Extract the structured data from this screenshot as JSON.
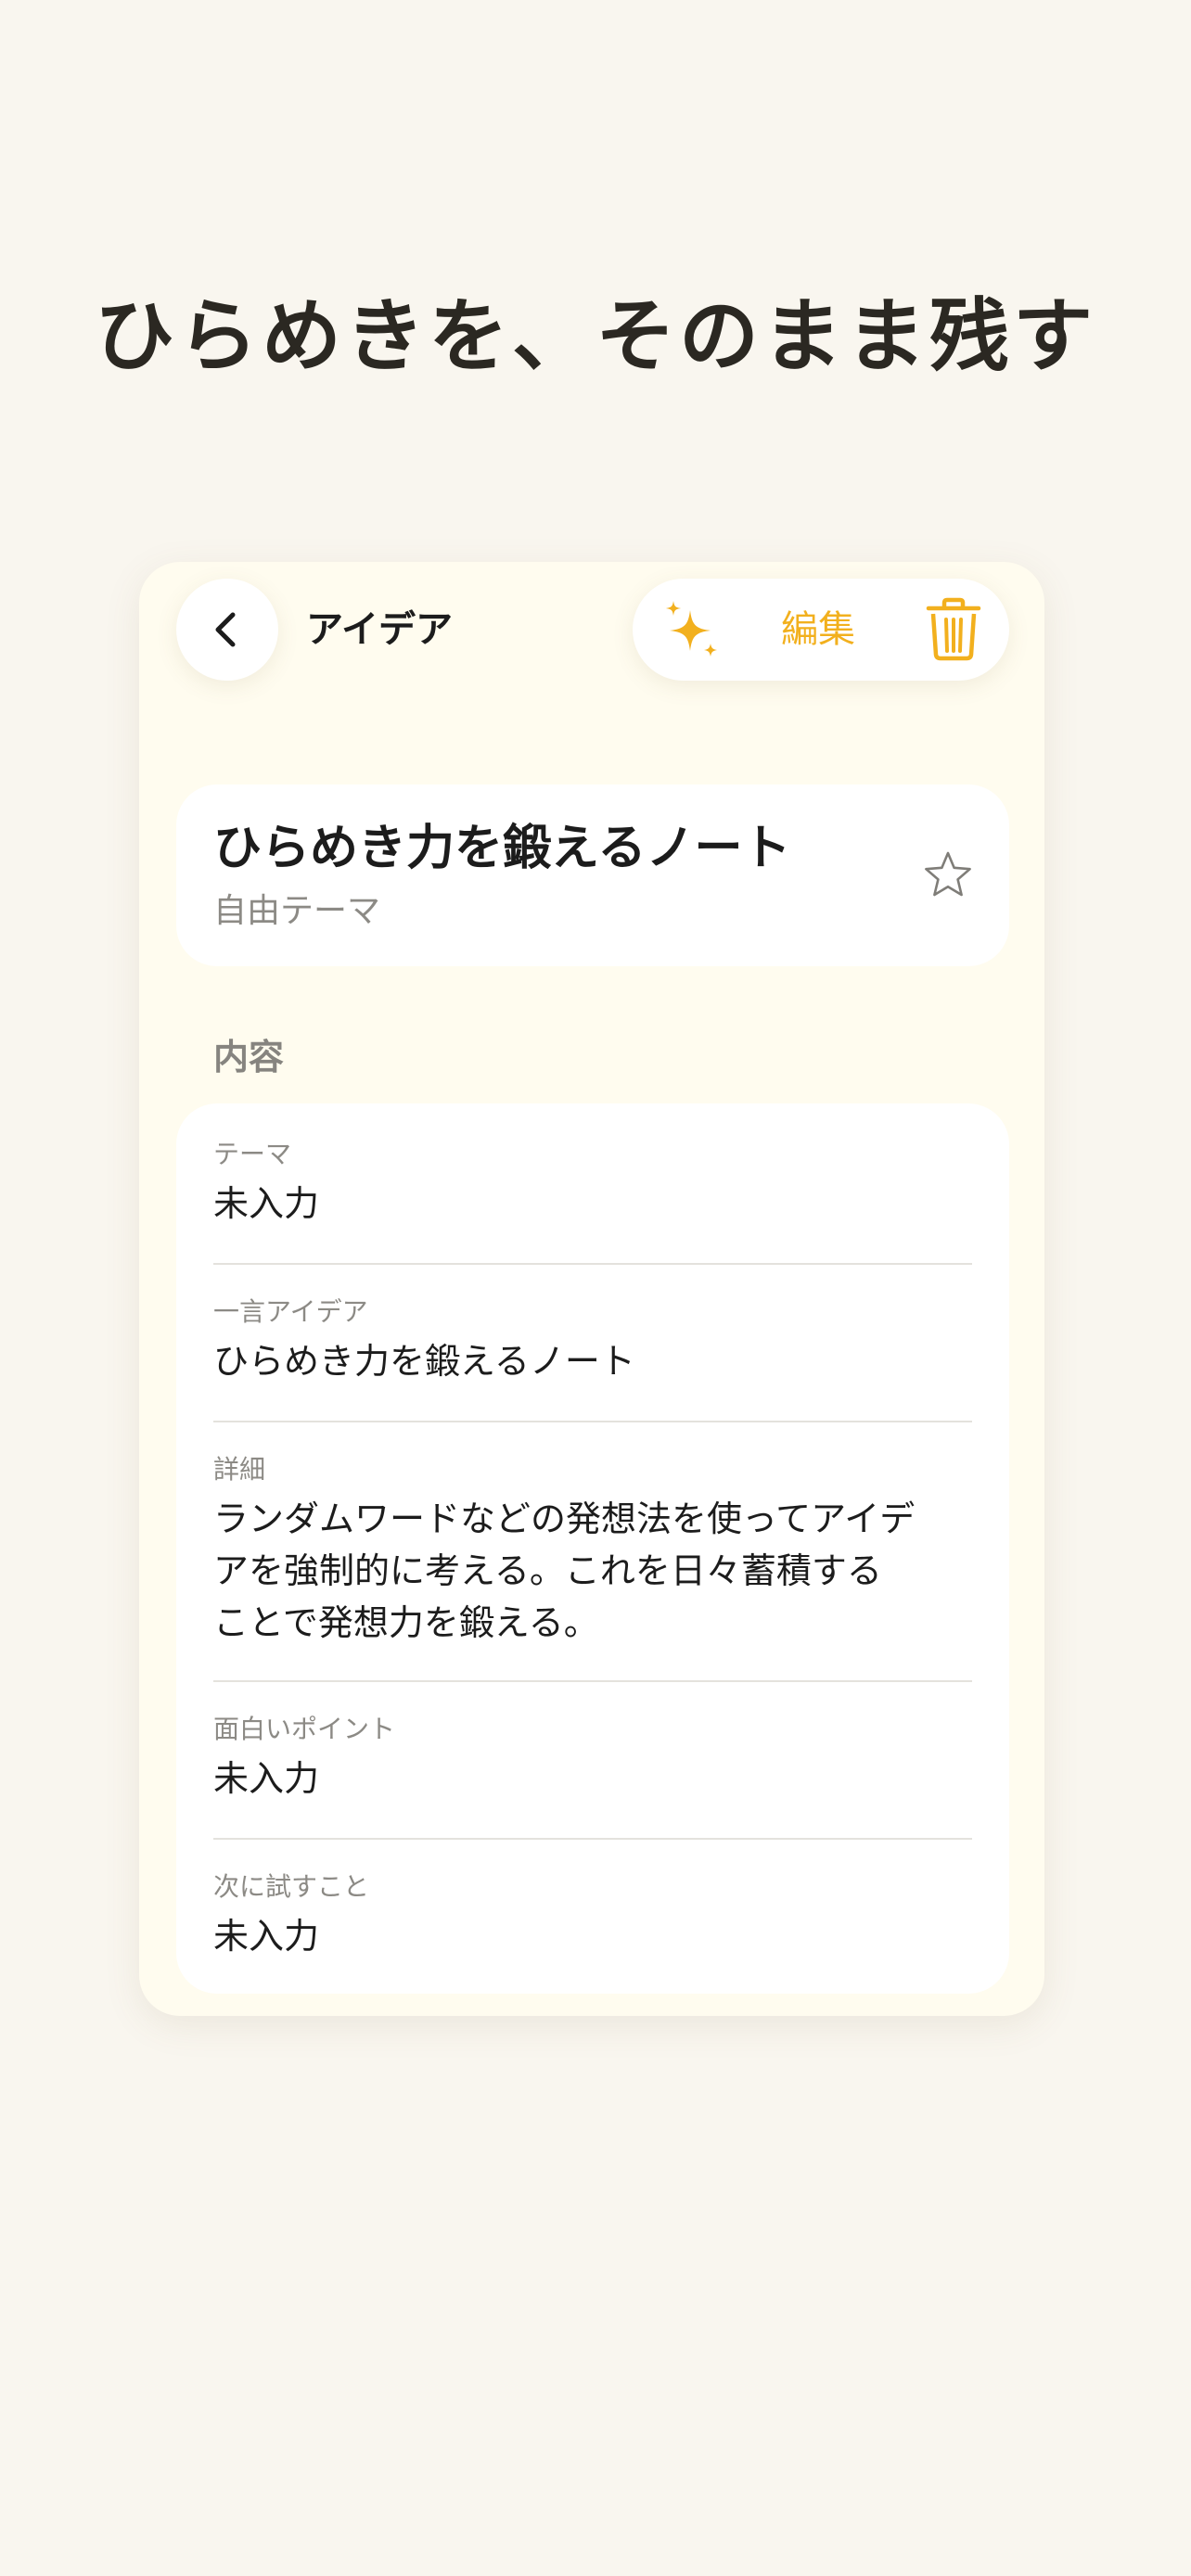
{
  "headline": "ひらめきを、そのまま残す",
  "nav": {
    "title": "アイデア",
    "edit_label": "編集"
  },
  "note": {
    "title": "ひらめき力を鍛えるノート",
    "subtitle": "自由テーマ",
    "favorite": false
  },
  "section": {
    "label": "内容"
  },
  "fields": [
    {
      "label": "テーマ",
      "value": "未入力"
    },
    {
      "label": "一言アイデア",
      "value": "ひらめき力を鍛えるノート"
    },
    {
      "label": "詳細",
      "value_lines": [
        "ランダムワードなどの発想法を使ってアイデ",
        "アを強制的に考える。これを日々蓄積する",
        "ことで発想力を鍛える。"
      ]
    },
    {
      "label": "面白いポイント",
      "value": "未入力"
    },
    {
      "label": "次に試すこと",
      "value": "未入力"
    }
  ],
  "colors": {
    "background": "#f9f6ef",
    "card": "#fffcef",
    "accent": "#f2b01e",
    "text": "#1c1c1c",
    "muted": "#8c8a85"
  },
  "icons": {
    "back": "chevron-left-icon",
    "ai": "sparkle-icon",
    "delete": "trash-icon",
    "favorite": "star-outline-icon"
  }
}
